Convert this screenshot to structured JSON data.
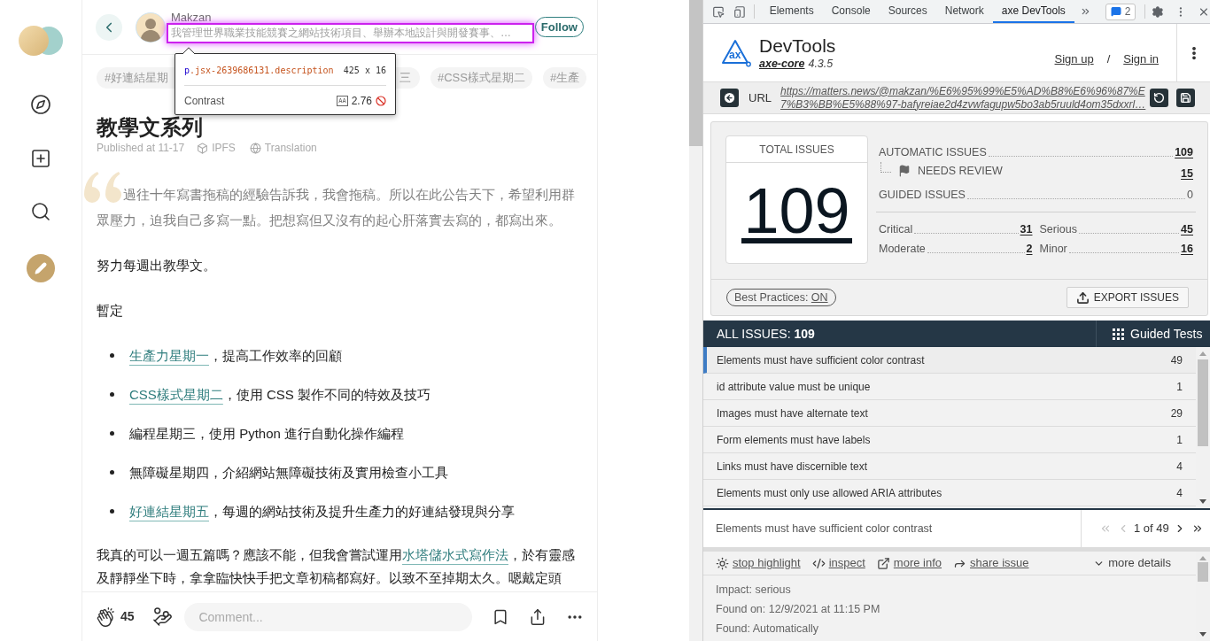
{
  "article": {
    "author": {
      "name": "Makzan",
      "description": "我管理世界職業技能競賽之網站技術項目、舉辦本地設計與開發賽事、…"
    },
    "follow": "Follow",
    "tags": [
      "#好連結星期",
      "三",
      "#CSS樣式星期二",
      "#生產"
    ],
    "title": "教學文系列",
    "published": "Published at 11-17",
    "ipfs": "IPFS",
    "translation": "Translation",
    "body": [
      {
        "kind": "quote",
        "text": "過往十年寫書拖稿的經驗告訴我，我會拖稿。所以在此公告天下，希望利用群眾壓力，迫我自己多寫一點。把想寫但又沒有的起心肝落實去寫的，都寫出來。"
      },
      {
        "kind": "paragraph",
        "parts": [
          {
            "kind": "text",
            "text": "努力每週出教學文。"
          }
        ]
      },
      {
        "kind": "paragraph",
        "parts": [
          {
            "kind": "text",
            "text": "暫定"
          }
        ]
      },
      {
        "kind": "list",
        "items": [
          {
            "parts": [
              {
                "kind": "link",
                "text": "生產力星期一"
              },
              {
                "kind": "text",
                "text": "，提高工作效率的回顧"
              }
            ]
          },
          {
            "parts": [
              {
                "kind": "link",
                "text": "CSS樣式星期二"
              },
              {
                "kind": "text",
                "text": "，使用 CSS 製作不同的特效及技巧"
              }
            ]
          },
          {
            "parts": [
              {
                "kind": "text",
                "text": "編程星期三，使用 Python 進行自動化操作編程"
              }
            ]
          },
          {
            "parts": [
              {
                "kind": "text",
                "text": "無障礙星期四，介紹網站無障礙技術及實用檢查小工具"
              }
            ]
          },
          {
            "parts": [
              {
                "kind": "link",
                "text": "好連結星期五"
              },
              {
                "kind": "text",
                "text": "，每週的網站技術及提升生產力的好連結發現與分享"
              }
            ]
          }
        ]
      },
      {
        "kind": "paragraph",
        "parts": [
          {
            "kind": "text",
            "text": "我真的可以一週五篇嗎？應該不能，但我會嘗試運用"
          },
          {
            "kind": "link",
            "text": "水塔儲水式寫作法"
          },
          {
            "kind": "text",
            "text": "，於有靈感及靜靜坐下時，拿拿臨快快手把文章初稿都寫好。以致不至掉期太久。嗯戴定頭"
          }
        ]
      }
    ],
    "claps": "45",
    "comment_placeholder": "Comment..."
  },
  "inspector": {
    "tag": "p",
    "selector": ".jsx-2639686131.description",
    "size": "425 x 16",
    "contrast_label": "Contrast",
    "aa": "AA",
    "contrast": "2.76",
    "contrast_pass": false
  },
  "devtools": {
    "tabs": [
      {
        "label": "Elements",
        "selected": false
      },
      {
        "label": "Console",
        "selected": false
      },
      {
        "label": "Sources",
        "selected": false
      },
      {
        "label": "Network",
        "selected": false
      },
      {
        "label": "axe DevTools",
        "selected": true
      }
    ],
    "issues_badge": "2",
    "axe": {
      "logo_text": "ax",
      "product": "DevTools",
      "engine": "axe-core",
      "version": "4.3.5",
      "sign_up": "Sign up",
      "separator": "/",
      "sign_in": "Sign in",
      "url_label": "URL",
      "url": "https://matters.news/@makzan/%E6%95%99%E5%AD%B8%E6%96%87%E7%B3%BB%E5%88%97-bafyreiae2d4zvwfagupw5bo3ab5ruuld4om35dxxrl…"
    },
    "summary": {
      "total_label": "TOTAL ISSUES",
      "total": "109",
      "automatic_label": "AUTOMATIC ISSUES",
      "automatic": "109",
      "needs_review_label": "NEEDS REVIEW",
      "needs_review": "15",
      "guided_label": "GUIDED ISSUES",
      "guided": "0",
      "impacts": [
        {
          "label": "Critical",
          "count": "31"
        },
        {
          "label": "Serious",
          "count": "45"
        },
        {
          "label": "Moderate",
          "count": "2"
        },
        {
          "label": "Minor",
          "count": "16"
        }
      ],
      "best_practices_label": "Best Practices:",
      "best_practices": "ON",
      "export": "EXPORT ISSUES"
    },
    "all_issues": {
      "label": "ALL ISSUES:",
      "count": "109",
      "guided_tests": "Guided Tests"
    },
    "issues": [
      {
        "name": "Elements must have sufficient color contrast",
        "count": "49",
        "selected": true
      },
      {
        "name": "id attribute value must be unique",
        "count": "1",
        "selected": false
      },
      {
        "name": "Images must have alternate text",
        "count": "29",
        "selected": false
      },
      {
        "name": "Form elements must have labels",
        "count": "1",
        "selected": false
      },
      {
        "name": "Links must have discernible text",
        "count": "4",
        "selected": false
      },
      {
        "name": "Elements must only use allowed ARIA attributes",
        "count": "4",
        "selected": false
      }
    ],
    "current": {
      "name": "Elements must have sufficient color contrast",
      "position": "1 of 49",
      "pager": [
        {
          "kind": "first",
          "disabled": true
        },
        {
          "kind": "prev",
          "disabled": true
        },
        {
          "kind": "next",
          "disabled": false
        },
        {
          "kind": "last",
          "disabled": false
        }
      ],
      "actions": [
        {
          "kind": "highlight",
          "label": "stop highlight"
        },
        {
          "kind": "inspect",
          "label": "inspect"
        },
        {
          "kind": "info",
          "label": "more info"
        },
        {
          "kind": "share",
          "label": "share issue"
        }
      ],
      "more_details": "more details",
      "details": [
        "Impact: serious",
        "Found on: 12/9/2021 at 11:15 PM",
        "Found: Automatically"
      ]
    }
  }
}
